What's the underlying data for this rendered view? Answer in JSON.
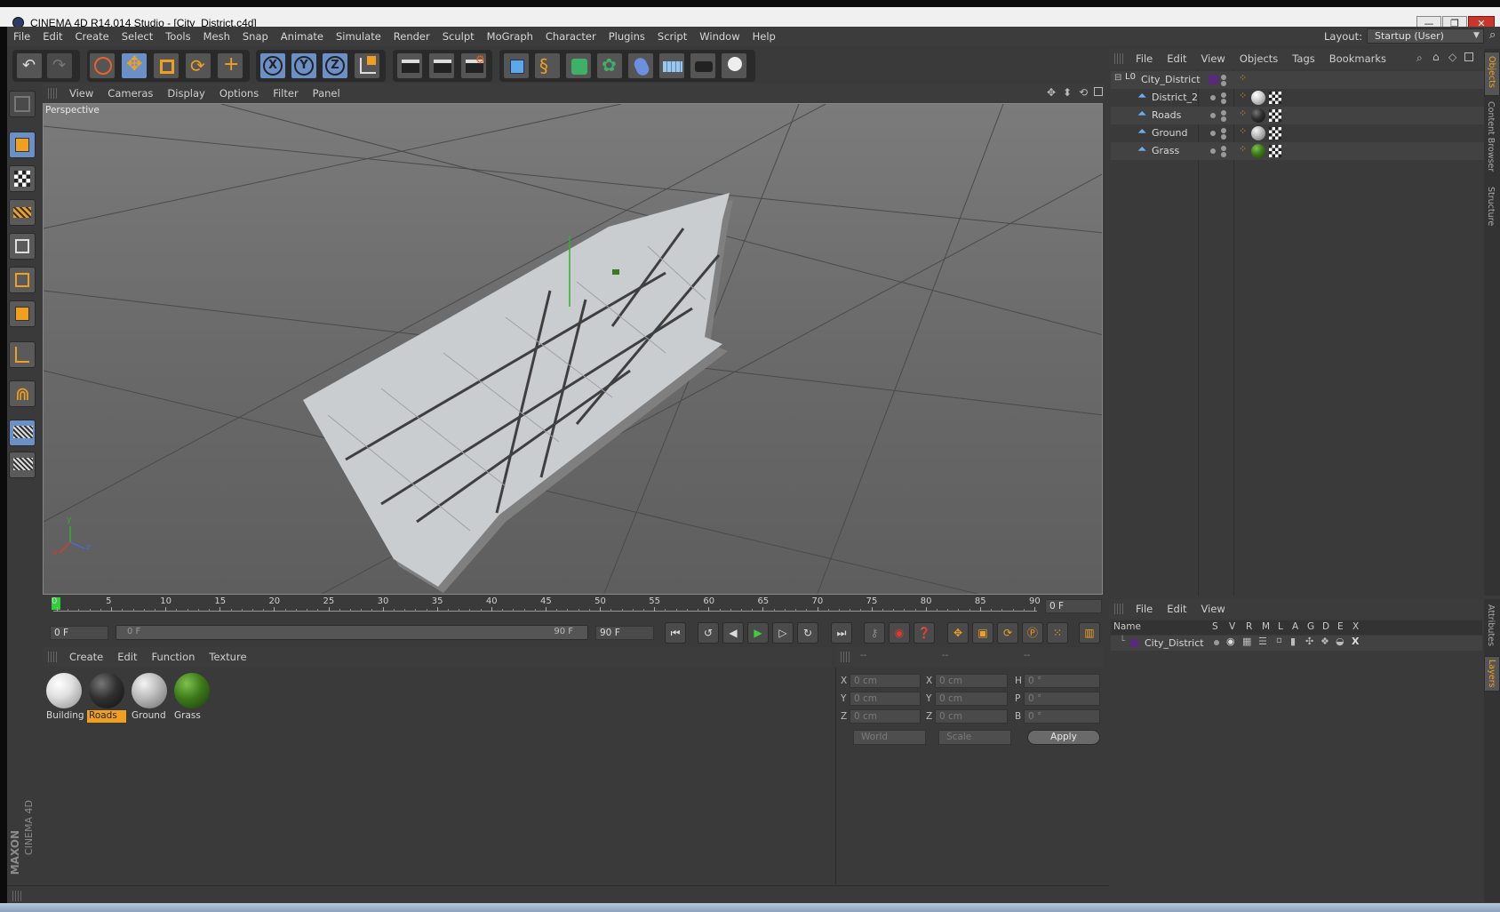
{
  "window": {
    "title": "CINEMA 4D R14.014 Studio - [City_District.c4d]",
    "minimize": "—",
    "restore": "❐",
    "close": "✕"
  },
  "menu": [
    "File",
    "Edit",
    "Create",
    "Select",
    "Tools",
    "Mesh",
    "Snap",
    "Animate",
    "Simulate",
    "Render",
    "Sculpt",
    "MoGraph",
    "Character",
    "Plugins",
    "Script",
    "Window",
    "Help"
  ],
  "layout": {
    "label": "Layout:",
    "value": "Startup (User)"
  },
  "viewport": {
    "menu": [
      "View",
      "Cameras",
      "Display",
      "Options",
      "Filter",
      "Panel"
    ],
    "camera_label": "Perspective",
    "axis": {
      "x": "x",
      "y": "y",
      "z": "z"
    }
  },
  "objects_panel": {
    "menu": [
      "File",
      "Edit",
      "View",
      "Objects",
      "Tags",
      "Bookmarks"
    ],
    "items": [
      {
        "name": "City_District",
        "level": 0
      },
      {
        "name": "District_2",
        "level": 1
      },
      {
        "name": "Roads",
        "level": 1
      },
      {
        "name": "Ground",
        "level": 1
      },
      {
        "name": "Grass",
        "level": 1
      }
    ],
    "side_tabs": [
      "Objects",
      "Content Browser",
      "Structure"
    ]
  },
  "timeline": {
    "ticks": [
      "0",
      "5",
      "10",
      "15",
      "20",
      "25",
      "30",
      "35",
      "40",
      "45",
      "50",
      "55",
      "60",
      "65",
      "70",
      "75",
      "80",
      "85",
      "90"
    ],
    "current_frame": "0 F",
    "start_field": "0 F",
    "range_start": "0 F",
    "range_end": "90 F",
    "end_field": "90 F"
  },
  "materials": {
    "menu": [
      "Create",
      "Edit",
      "Function",
      "Texture"
    ],
    "items": [
      {
        "name": "Building",
        "color": "#e0e0e0",
        "selected": false
      },
      {
        "name": "Roads",
        "color": "#303030",
        "selected": true
      },
      {
        "name": "Ground",
        "color": "#b8b8b8",
        "selected": false
      },
      {
        "name": "Grass",
        "color": "#3d7a1a",
        "selected": false
      }
    ]
  },
  "coordinates": {
    "headers": [
      "--",
      "--",
      "--"
    ],
    "rows": [
      {
        "a": "X",
        "av": "0 cm",
        "b": "X",
        "bv": "0 cm",
        "c": "H",
        "cv": "0 °"
      },
      {
        "a": "Y",
        "av": "0 cm",
        "b": "Y",
        "bv": "0 cm",
        "c": "P",
        "cv": "0 °"
      },
      {
        "a": "Z",
        "av": "0 cm",
        "b": "Z",
        "bv": "0 cm",
        "c": "B",
        "cv": "0 °"
      }
    ],
    "space": "World",
    "mode": "Scale",
    "apply": "Apply"
  },
  "layers_panel": {
    "menu": [
      "File",
      "Edit",
      "View"
    ],
    "columns": {
      "name": "Name",
      "flags": [
        "S",
        "V",
        "R",
        "M",
        "L",
        "A",
        "G",
        "D",
        "E",
        "X"
      ]
    },
    "items": [
      {
        "name": "City_District"
      }
    ],
    "side_tabs": [
      "Attributes",
      "Layers"
    ]
  },
  "brand": {
    "maxon": "MAXON",
    "product": "CINEMA 4D"
  }
}
